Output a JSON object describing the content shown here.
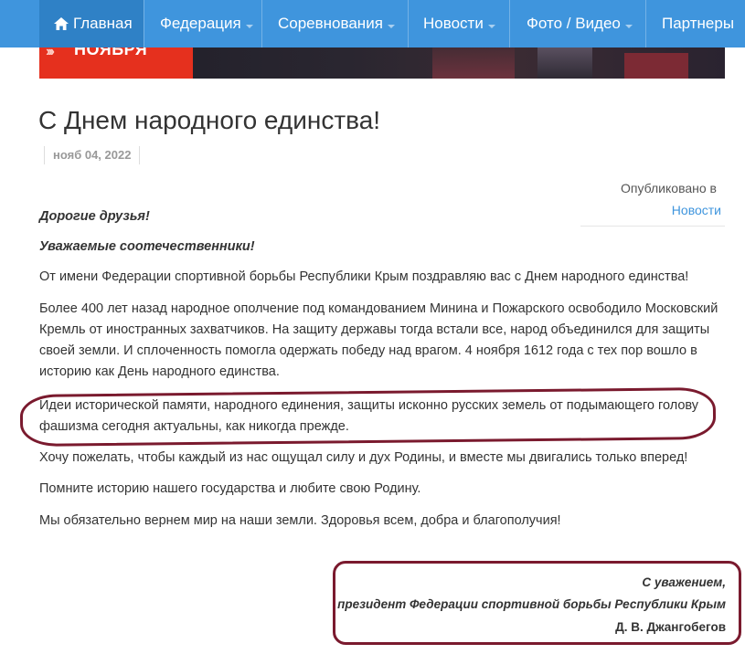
{
  "nav": {
    "items": [
      {
        "label": "Главная",
        "active": true,
        "icon": "home-icon",
        "dropdown": false
      },
      {
        "label": "Федерация",
        "active": false,
        "dropdown": true
      },
      {
        "label": "Соревнования",
        "active": false,
        "dropdown": true
      },
      {
        "label": "Новости",
        "active": false,
        "dropdown": true
      },
      {
        "label": "Фото / Видео",
        "active": false,
        "dropdown": true
      },
      {
        "label": "Партнеры",
        "active": false,
        "dropdown": false
      }
    ],
    "bar_color": "#3f95dd",
    "active_color": "#2f81c6"
  },
  "banner": {
    "text": "НОЯБРЯ",
    "chevrons": "›››",
    "accent_color": "#e5301e"
  },
  "article": {
    "title": "С Днем народного единства!",
    "date": "нояб 04, 2022",
    "published_label": "Опубликовано в",
    "category_link": "Новости",
    "greeting1": "Дорогие друзья!",
    "greeting2": "Уважаемые соотечественники!",
    "paragraphs": [
      "От имени Федерации спортивной борьбы Республики Крым поздравляю вас с Днем народного единства!",
      "Более 400 лет назад народное ополчение под командованием Минина и Пожарского освободило Московский Кремль от иностранных захватчиков. На защиту державы тогда встали все, народ объединился для защиты своей земли. И сплоченность помогла одержать победу над врагом. 4 ноября 1612 года с тех пор вошло в историю как День народного единства.",
      "Идеи исторической памяти, народного единения, защиты исконно русских земель от подымающего голову фашизма сегодня актуальны, как никогда прежде.",
      "Хочу пожелать, чтобы каждый из нас ощущал силу и дух Родины, и вместе мы двигались только вперед!",
      "Помните историю нашего государства и любите свою Родину.",
      "Мы обязательно вернем мир на наши земли. Здоровья всем, добра и благополучия!"
    ],
    "signature": {
      "regards": "С уважением,",
      "position": "президент Федерации спортивной борьбы Республики Крым",
      "name": "Д. В. Джангобегов"
    },
    "highlight_color": "#7a1a2e",
    "link_color": "#3f95dd"
  }
}
